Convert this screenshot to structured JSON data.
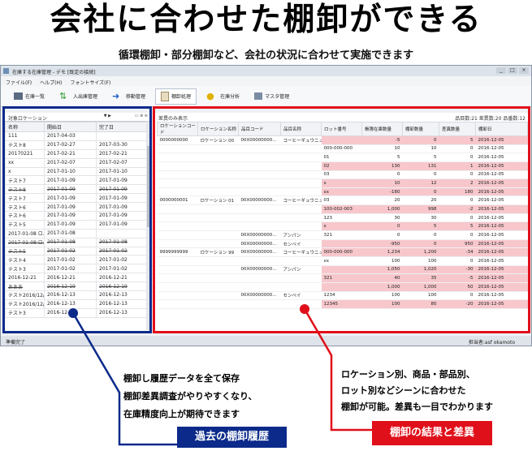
{
  "headline": "会社に合わせた棚卸ができる",
  "subheadline": "循環棚卸・部分棚卸など、会社の状況に合わせて実施できます",
  "window": {
    "title": "在庫する在庫管理 - デモ [既定の接続]",
    "controls": [
      "_",
      "□",
      "×"
    ]
  },
  "menu": [
    "ファイル(F)",
    "ヘルプ(H)",
    "フォントサイズ(F)"
  ],
  "toolbar": [
    "在庫一覧",
    "入出庫管理",
    "移動管理",
    "棚卸処理",
    "在庫分析",
    "マスタ管理"
  ],
  "left_panel": {
    "selector": "対象ロケーション",
    "columns": [
      "名称",
      "開始日",
      "完了日"
    ],
    "rows": [
      [
        "111",
        "2017-04-03",
        ""
      ],
      [
        "テスト8",
        "2017-02-27",
        "2017-03-30"
      ],
      [
        "20170221",
        "2017-02-21",
        "2017-02-21"
      ],
      [
        "xx",
        "2017-02-07",
        "2017-02-07"
      ],
      [
        "x",
        "2017-01-10",
        "2017-01-10"
      ],
      [
        "テスト7",
        "2017-01-09",
        "2017-01-09"
      ],
      [
        "テスト8",
        "2017-01-09",
        "2017-01-09"
      ],
      [
        "テスト7",
        "2017-01-09",
        "2017-01-09"
      ],
      [
        "テスト6",
        "2017-01-09",
        "2017-01-09"
      ],
      [
        "テスト6",
        "2017-01-09",
        "2017-01-09"
      ],
      [
        "テスト5",
        "2017-01-09",
        "2017-01-09"
      ],
      [
        "2017-01-08 ロ...",
        "2017-01-08",
        ""
      ],
      [
        "2017-01-08 ロ...",
        "2017-01-08",
        "2017-01-08"
      ],
      [
        "テスト5",
        "2017-01-02",
        "2017-01-02"
      ],
      [
        "テスト4",
        "2017-01-02",
        "2017-01-02"
      ],
      [
        "テスト3",
        "2017-01-02",
        "2017-01-02"
      ],
      [
        "2016-12-21",
        "2016-12-21",
        "2016-12-21"
      ],
      [
        "あああ",
        "2016-12-19",
        "2016-12-19"
      ],
      [
        "テスト2016/12/...",
        "2016-12-13",
        "2016-12-13"
      ],
      [
        "テスト2016/12/13",
        "2016-12-13",
        "2016-12-13"
      ],
      [
        "テスト3",
        "2016-12-13",
        "2016-12-13"
      ]
    ],
    "deleted_rows": [
      6,
      12,
      13,
      17
    ]
  },
  "right_panel": {
    "filter": "差異のみ表示",
    "counts": "品目数:21 差異数:20 品番数:12",
    "columns": [
      "ロケーションコード",
      "ロケーション名称",
      "品目コード",
      "品目名称",
      "ロット番号",
      "帳簿在庫数量",
      "棚卸数量",
      "差異数量",
      "棚卸日"
    ],
    "rows": [
      [
        "0000000000",
        "ロケーション 00",
        "00X00000000...",
        "コーヒーギュウニュウ",
        "",
        "-5",
        "0",
        "5",
        "2016-12-05"
      ],
      [
        "",
        "",
        "",
        "",
        "000-000-000",
        "10",
        "10",
        "0",
        "2016-12-05"
      ],
      [
        "",
        "",
        "",
        "",
        "01",
        "5",
        "5",
        "0",
        "2016-12-05"
      ],
      [
        "",
        "",
        "",
        "",
        "02",
        "130",
        "131",
        "1",
        "2016-12-05"
      ],
      [
        "",
        "",
        "",
        "",
        "03",
        "0",
        "0",
        "0",
        "2016-12-05"
      ],
      [
        "",
        "",
        "",
        "",
        "x",
        "10",
        "12",
        "2",
        "2016-12-05"
      ],
      [
        "",
        "",
        "",
        "",
        "xx",
        "-180",
        "0",
        "180",
        "2016-12-05"
      ],
      [
        "0000000001",
        "ロケーション 01",
        "00X00000000...",
        "コーヒーギュウニュウ",
        "03",
        "20",
        "20",
        "0",
        "2016-12-05"
      ],
      [
        "",
        "",
        "",
        "",
        "100-002-003",
        "1,000",
        "998",
        "-2",
        "2016-12-05"
      ],
      [
        "",
        "",
        "",
        "",
        "123",
        "30",
        "30",
        "0",
        "2016-12-05"
      ],
      [
        "",
        "",
        "",
        "",
        "x",
        "0",
        "5",
        "5",
        "2016-12-05"
      ],
      [
        "",
        "",
        "00X00000000...",
        "アンパン",
        "321",
        "0",
        "0",
        "0",
        "2016-12-05"
      ],
      [
        "",
        "",
        "00X00000000...",
        "センベイ",
        "",
        "-950",
        "0",
        "950",
        "2016-12-05"
      ],
      [
        "9999999999",
        "ロケーション 99",
        "00X00000000...",
        "コーヒーギュウニュウ",
        "000-000-000",
        "1,234",
        "1,200",
        "-34",
        "2016-12-05"
      ],
      [
        "",
        "",
        "",
        "",
        "xx",
        "100",
        "100",
        "0",
        "2016-12-05"
      ],
      [
        "",
        "",
        "00X00000000...",
        "アンパン",
        "",
        "1,050",
        "1,020",
        "-30",
        "2016-12-05"
      ],
      [
        "",
        "",
        "",
        "",
        "321",
        "40",
        "35",
        "-5",
        "2016-12-05"
      ],
      [
        "",
        "",
        "",
        "",
        "",
        "1,000",
        "1,000",
        "50",
        "2016-12-05"
      ],
      [
        "",
        "",
        "00X00000000...",
        "センベイ",
        "1234",
        "100",
        "100",
        "0",
        "2016-12-05"
      ],
      [
        "",
        "",
        "",
        "",
        "12345",
        "100",
        "80",
        "-20",
        "2016-12-05"
      ]
    ],
    "pink_rows": [
      0,
      3,
      5,
      6,
      8,
      10,
      12,
      13,
      15,
      16,
      17,
      19
    ]
  },
  "statusbar": {
    "left": "準備完了",
    "right": "担当者:asf   okamoto"
  },
  "annotation_left": {
    "lines": [
      "棚卸し履歴データを全て保存",
      "棚卸差異調査がやりやすくなり、",
      "在庫精度向上が期待できます"
    ],
    "label": "過去の棚卸履歴"
  },
  "annotation_right": {
    "lines": [
      "ロケーション別、商品・部品別、",
      "ロット別などシーンに合わせた",
      "棚卸が可能。差異も一目でわかります"
    ],
    "label": "棚卸の結果と差異"
  },
  "colors": {
    "blue": "#0b2a8a",
    "red": "#e0101a",
    "pink": "#f7c7cc"
  }
}
